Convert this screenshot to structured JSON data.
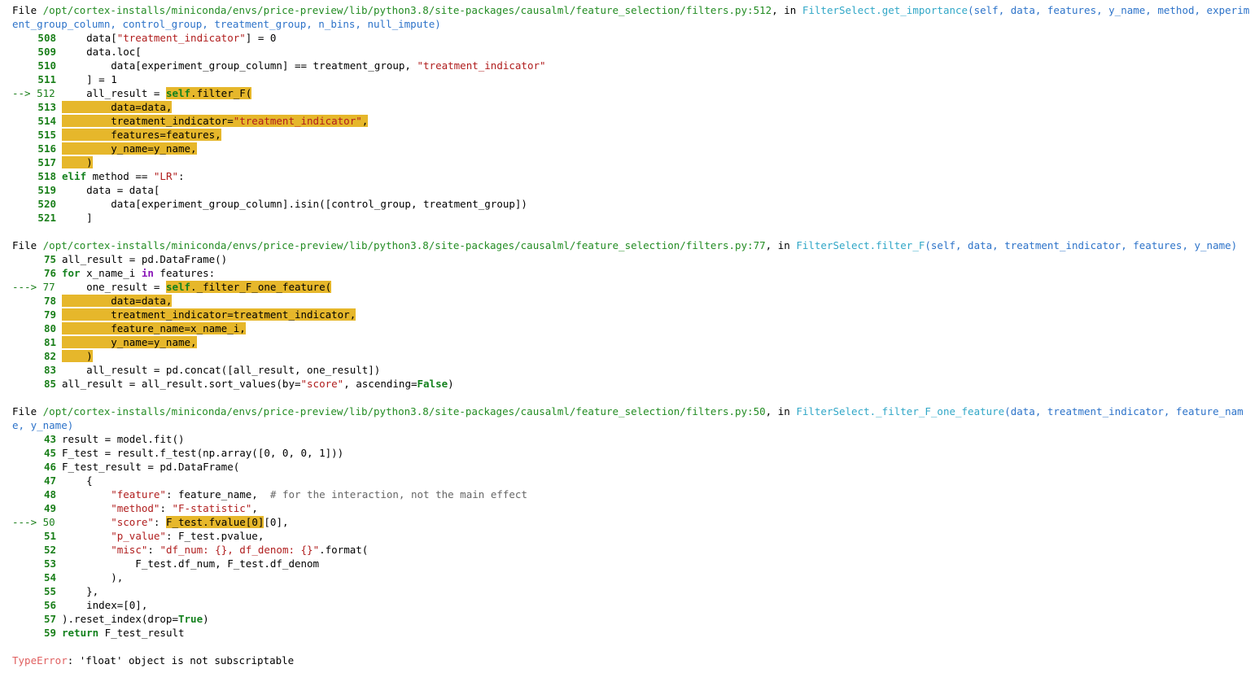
{
  "frames": [
    {
      "file_prefix": "File",
      "path": "/opt/cortex-installs/miniconda/envs/price-preview/lib/python3.8/site-packages/causalml/feature_selection/filters.py:512",
      "in_word": "in",
      "func": "FilterSelect.get_importance",
      "args": "(self, data, features, y_name, method, experiment_group_column, control_group, treatment_group, n_bins, null_impute)",
      "lines": [
        {
          "no": "508",
          "arrow": false,
          "segs": [
            {
              "t": "    data["
            },
            {
              "t": "\"treatment_indicator\"",
              "c": "str"
            },
            {
              "t": "] = 0"
            }
          ]
        },
        {
          "no": "509",
          "arrow": false,
          "segs": [
            {
              "t": "    data.loc["
            }
          ]
        },
        {
          "no": "510",
          "arrow": false,
          "segs": [
            {
              "t": "        data[experiment_group_column] == treatment_group, "
            },
            {
              "t": "\"treatment_indicator\"",
              "c": "str"
            }
          ]
        },
        {
          "no": "511",
          "arrow": false,
          "segs": [
            {
              "t": "    ] = 1"
            }
          ]
        },
        {
          "no": "512",
          "arrow": true,
          "arrow_text": "--> ",
          "segs": [
            {
              "t": "    all_result = "
            },
            {
              "t": "self",
              "c": "kw",
              "hl": true
            },
            {
              "t": ".filter_F(",
              "hl": true
            }
          ]
        },
        {
          "no": "513",
          "arrow": false,
          "segs": [
            {
              "t": "        data=data,",
              "hl": true
            }
          ]
        },
        {
          "no": "514",
          "arrow": false,
          "segs": [
            {
              "t": "        treatment_indicator=",
              "hl": true
            },
            {
              "t": "\"treatment_indicator\"",
              "c": "str",
              "hl": true
            },
            {
              "t": ",",
              "hl": true
            }
          ]
        },
        {
          "no": "515",
          "arrow": false,
          "segs": [
            {
              "t": "        features=features,",
              "hl": true
            }
          ]
        },
        {
          "no": "516",
          "arrow": false,
          "segs": [
            {
              "t": "        y_name=y_name,",
              "hl": true
            }
          ]
        },
        {
          "no": "517",
          "arrow": false,
          "segs": [
            {
              "t": "    )",
              "hl": true
            }
          ]
        },
        {
          "no": "518",
          "arrow": false,
          "segs": [
            {
              "t": "elif",
              "c": "kw"
            },
            {
              "t": " method == "
            },
            {
              "t": "\"LR\"",
              "c": "str"
            },
            {
              "t": ":"
            }
          ]
        },
        {
          "no": "519",
          "arrow": false,
          "segs": [
            {
              "t": "    data = data["
            }
          ]
        },
        {
          "no": "520",
          "arrow": false,
          "segs": [
            {
              "t": "        data[experiment_group_column].isin([control_group, treatment_group])"
            }
          ]
        },
        {
          "no": "521",
          "arrow": false,
          "segs": [
            {
              "t": "    ]"
            }
          ]
        }
      ]
    },
    {
      "file_prefix": "File",
      "path": "/opt/cortex-installs/miniconda/envs/price-preview/lib/python3.8/site-packages/causalml/feature_selection/filters.py:77",
      "in_word": "in",
      "func": "FilterSelect.filter_F",
      "args": "(self, data, treatment_indicator, features, y_name)",
      "lines": [
        {
          "no": "75",
          "arrow": false,
          "segs": [
            {
              "t": "all_result = pd.DataFrame()"
            }
          ]
        },
        {
          "no": "76",
          "arrow": false,
          "segs": [
            {
              "t": "for",
              "c": "kw"
            },
            {
              "t": " x_name_i "
            },
            {
              "t": "in",
              "c": "kw2"
            },
            {
              "t": " features:"
            }
          ]
        },
        {
          "no": "77",
          "arrow": true,
          "arrow_text": "---> ",
          "segs": [
            {
              "t": "    one_result = "
            },
            {
              "t": "self",
              "c": "kw",
              "hl": true
            },
            {
              "t": "._filter_F_one_feature(",
              "hl": true
            }
          ]
        },
        {
          "no": "78",
          "arrow": false,
          "segs": [
            {
              "t": "        data=data,",
              "hl": true
            }
          ]
        },
        {
          "no": "79",
          "arrow": false,
          "segs": [
            {
              "t": "        treatment_indicator=treatment_indicator,",
              "hl": true
            }
          ]
        },
        {
          "no": "80",
          "arrow": false,
          "segs": [
            {
              "t": "        feature_name=x_name_i,",
              "hl": true
            }
          ]
        },
        {
          "no": "81",
          "arrow": false,
          "segs": [
            {
              "t": "        y_name=y_name,",
              "hl": true
            }
          ]
        },
        {
          "no": "82",
          "arrow": false,
          "segs": [
            {
              "t": "    )",
              "hl": true
            }
          ]
        },
        {
          "no": "83",
          "arrow": false,
          "segs": [
            {
              "t": "    all_result = pd.concat([all_result, one_result])"
            }
          ]
        },
        {
          "no": "85",
          "arrow": false,
          "segs": [
            {
              "t": "all_result = all_result.sort_values(by="
            },
            {
              "t": "\"score\"",
              "c": "str"
            },
            {
              "t": ", ascending="
            },
            {
              "t": "False",
              "c": "kw"
            },
            {
              "t": ")"
            }
          ]
        }
      ]
    },
    {
      "file_prefix": "File",
      "path": "/opt/cortex-installs/miniconda/envs/price-preview/lib/python3.8/site-packages/causalml/feature_selection/filters.py:50",
      "in_word": "in",
      "func": "FilterSelect._filter_F_one_feature",
      "args": "(data, treatment_indicator, feature_name, y_name)",
      "lines": [
        {
          "no": "43",
          "arrow": false,
          "segs": [
            {
              "t": "result = model.fit()"
            }
          ]
        },
        {
          "no": "45",
          "arrow": false,
          "segs": [
            {
              "t": "F_test = result.f_test(np.array([0, 0, 0, 1]))"
            }
          ]
        },
        {
          "no": "46",
          "arrow": false,
          "segs": [
            {
              "t": "F_test_result = pd.DataFrame("
            }
          ]
        },
        {
          "no": "47",
          "arrow": false,
          "segs": [
            {
              "t": "    {"
            }
          ]
        },
        {
          "no": "48",
          "arrow": false,
          "segs": [
            {
              "t": "        "
            },
            {
              "t": "\"feature\"",
              "c": "str"
            },
            {
              "t": ": feature_name,  "
            },
            {
              "t": "# for the interaction, not the main effect",
              "c": "comment"
            }
          ]
        },
        {
          "no": "49",
          "arrow": false,
          "segs": [
            {
              "t": "        "
            },
            {
              "t": "\"method\"",
              "c": "str"
            },
            {
              "t": ": "
            },
            {
              "t": "\"F-statistic\"",
              "c": "str"
            },
            {
              "t": ","
            }
          ]
        },
        {
          "no": "50",
          "arrow": true,
          "arrow_text": "---> ",
          "segs": [
            {
              "t": "        "
            },
            {
              "t": "\"score\"",
              "c": "str"
            },
            {
              "t": ": "
            },
            {
              "t": "F_test.fvalue[0]",
              "hl": true
            },
            {
              "t": "[0],"
            }
          ]
        },
        {
          "no": "51",
          "arrow": false,
          "segs": [
            {
              "t": "        "
            },
            {
              "t": "\"p_value\"",
              "c": "str"
            },
            {
              "t": ": F_test.pvalue,"
            }
          ]
        },
        {
          "no": "52",
          "arrow": false,
          "segs": [
            {
              "t": "        "
            },
            {
              "t": "\"misc\"",
              "c": "str"
            },
            {
              "t": ": "
            },
            {
              "t": "\"df_num: {}, df_denom: {}\"",
              "c": "str"
            },
            {
              "t": ".format("
            }
          ]
        },
        {
          "no": "53",
          "arrow": false,
          "segs": [
            {
              "t": "            F_test.df_num, F_test.df_denom"
            }
          ]
        },
        {
          "no": "54",
          "arrow": false,
          "segs": [
            {
              "t": "        ),"
            }
          ]
        },
        {
          "no": "55",
          "arrow": false,
          "segs": [
            {
              "t": "    },"
            }
          ]
        },
        {
          "no": "56",
          "arrow": false,
          "segs": [
            {
              "t": "    index=[0],"
            }
          ]
        },
        {
          "no": "57",
          "arrow": false,
          "segs": [
            {
              "t": ").reset_index(drop="
            },
            {
              "t": "True",
              "c": "kw"
            },
            {
              "t": ")"
            }
          ]
        },
        {
          "no": "59",
          "arrow": false,
          "segs": [
            {
              "t": "return",
              "c": "kw"
            },
            {
              "t": " F_test_result"
            }
          ]
        }
      ]
    }
  ],
  "error": {
    "name": "TypeError",
    "message": ": 'float' object is not subscriptable"
  },
  "colors": {
    "highlight": "#e6b72b",
    "path": "#238c23",
    "func": "#31a7c7",
    "args": "#2d73c9",
    "lineno": "#1a7f1a",
    "string": "#b01d1d",
    "error_name": "#e06060"
  }
}
